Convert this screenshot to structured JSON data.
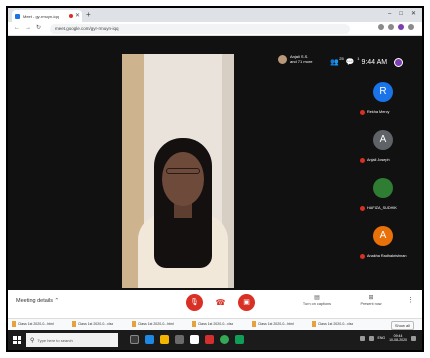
{
  "browser": {
    "tab_title": "Meet - gy-rmuyn-iqq",
    "new_tab": "+",
    "window_controls": [
      "–",
      "□",
      "✕"
    ],
    "url": "meet.google.com/gyr-rmuyn-iqq"
  },
  "meet": {
    "presenter_text": "Anjali S.S. and 71 more",
    "participant_count": "25",
    "chat_count": "1",
    "clock": "9:44 AM",
    "profile_initial": "",
    "participants": [
      {
        "initial": "R",
        "name": "Rekha Mercy",
        "color": "#1a73e8"
      },
      {
        "initial": "A",
        "name": "Anjali Joseph",
        "color": "#5f6368"
      },
      {
        "initial": "",
        "name": "HAFIZA_SUDHIK",
        "color": "#2e7d32"
      },
      {
        "initial": "A",
        "name": "Anakha Radhakrishnan",
        "color": "#e8710a"
      }
    ]
  },
  "bottom_bar": {
    "meeting_details": "Meeting details",
    "turn_on_captions": "Turn on captions",
    "present_now": "Present now",
    "more": "⋮"
  },
  "downloads": {
    "items": [
      "Class 1st 2020-0...html",
      "Class 1st 2020-0...xlsx",
      "Class 1st 2020-0...html",
      "Class 1st 2020-0...xlsx",
      "Class 1st 2020-0...html",
      "Class 1st 2020-0...xlsx"
    ],
    "show_all": "Show all"
  },
  "taskbar": {
    "search_placeholder": "Type here to search",
    "lang": "ENG",
    "time": "09:44",
    "date": "10-08-2020"
  }
}
